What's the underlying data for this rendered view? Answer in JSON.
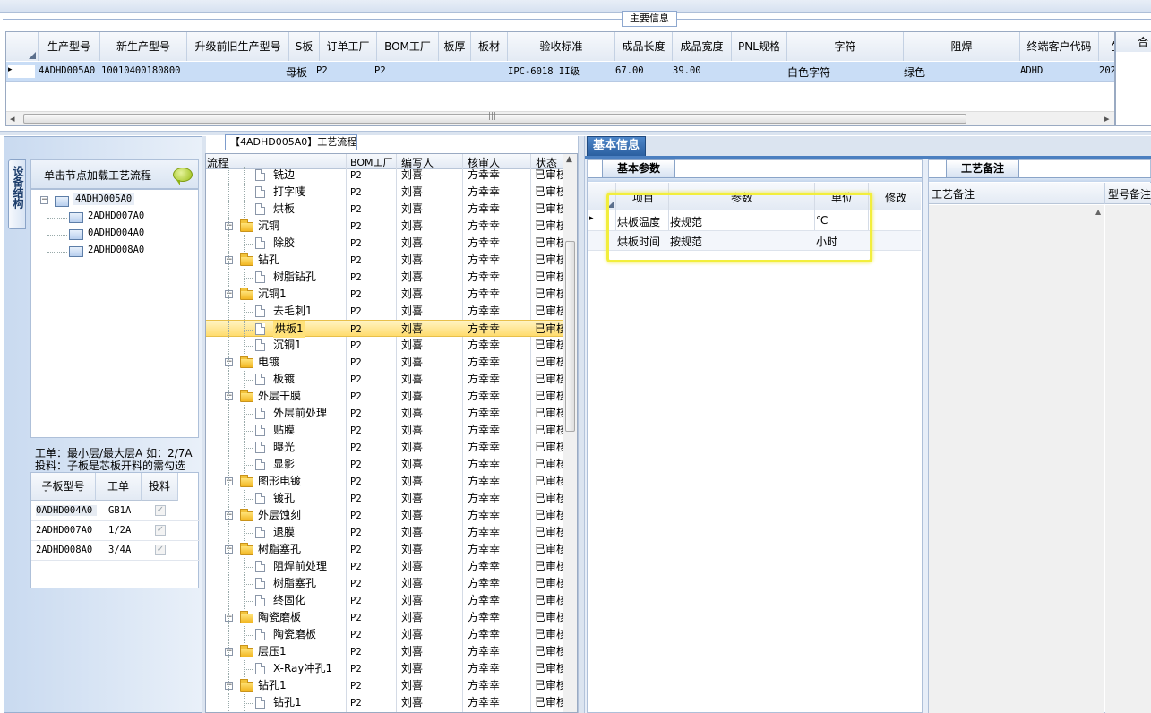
{
  "main_info": {
    "title": "主要信息",
    "columns": [
      "生产型号",
      "新生产型号",
      "升级前旧生产型号",
      "S板",
      "订单工厂",
      "BOM工厂",
      "板厚",
      "板材",
      "验收标准",
      "成品长度",
      "成品宽度",
      "PNL规格",
      "字符",
      "阻焊",
      "终端客户代码",
      "生"
    ],
    "row": [
      "4ADHD005A0",
      "10010400180800",
      "",
      "母板",
      "P2",
      "P2",
      "",
      "",
      "IPC-6018 II级",
      "67.00",
      "39.00",
      "",
      "白色字符",
      "绿色",
      "ADHD",
      "202"
    ],
    "right_header": "合",
    "row_indicator": "▸",
    "scroll_left": "◂",
    "scroll_right": "▸",
    "scroll_grip": "|||"
  },
  "left_panel": {
    "vertical_tab": "设备结构",
    "hint": "单击节点加载工艺流程",
    "tree_root": "4ADHD005A0",
    "tree_children": [
      "2ADHD007A0",
      "0ADHD004A0",
      "2ADHD008A0"
    ],
    "note_line1": "工单：最小层/最大层A 如：2/7A",
    "note_line2": "投料：子板是芯板开料的需勾选",
    "sub_columns": [
      "子板型号",
      "工单",
      "投料"
    ],
    "sub_rows": [
      {
        "model": "0ADHD004A0",
        "order": "GB1A",
        "feed": "✓"
      },
      {
        "model": "2ADHD007A0",
        "order": "1/2A",
        "feed": "✓"
      },
      {
        "model": "2ADHD008A0",
        "order": "3/4A",
        "feed": "✓"
      }
    ]
  },
  "flow_panel": {
    "title": "【4ADHD005A0】工艺流程",
    "columns": [
      "流程",
      "BOM工厂",
      "编写人",
      "核审人",
      "状态"
    ],
    "rows": [
      {
        "name": "铣边",
        "type": "leaf",
        "bom": "P2",
        "writer": "刘喜",
        "reviewer": "方幸幸",
        "status": "已审核"
      },
      {
        "name": "打字唛",
        "type": "leaf",
        "bom": "P2",
        "writer": "刘喜",
        "reviewer": "方幸幸",
        "status": "已审核"
      },
      {
        "name": "烘板",
        "type": "leaf",
        "bom": "P2",
        "writer": "刘喜",
        "reviewer": "方幸幸",
        "status": "已审核"
      },
      {
        "name": "沉铜",
        "type": "folder",
        "bom": "P2",
        "writer": "刘喜",
        "reviewer": "方幸幸",
        "status": "已审核"
      },
      {
        "name": "除胶",
        "type": "leaf",
        "bom": "P2",
        "writer": "刘喜",
        "reviewer": "方幸幸",
        "status": "已审核"
      },
      {
        "name": "钻孔",
        "type": "folder",
        "bom": "P2",
        "writer": "刘喜",
        "reviewer": "方幸幸",
        "status": "已审核"
      },
      {
        "name": "树脂钻孔",
        "type": "leaf",
        "bom": "P2",
        "writer": "刘喜",
        "reviewer": "方幸幸",
        "status": "已审核"
      },
      {
        "name": "沉铜1",
        "type": "folder",
        "bom": "P2",
        "writer": "刘喜",
        "reviewer": "方幸幸",
        "status": "已审核"
      },
      {
        "name": "去毛刺1",
        "type": "leaf",
        "bom": "P2",
        "writer": "刘喜",
        "reviewer": "方幸幸",
        "status": "已审核"
      },
      {
        "name": "烘板1",
        "type": "leaf",
        "bom": "P2",
        "writer": "刘喜",
        "reviewer": "方幸幸",
        "status": "已审核",
        "selected": true
      },
      {
        "name": "沉铜1",
        "type": "leaf",
        "bom": "P2",
        "writer": "刘喜",
        "reviewer": "方幸幸",
        "status": "已审核"
      },
      {
        "name": "电镀",
        "type": "folder",
        "bom": "P2",
        "writer": "刘喜",
        "reviewer": "方幸幸",
        "status": "已审核"
      },
      {
        "name": "板镀",
        "type": "leaf",
        "bom": "P2",
        "writer": "刘喜",
        "reviewer": "方幸幸",
        "status": "已审核"
      },
      {
        "name": "外层干膜",
        "type": "folder",
        "bom": "P2",
        "writer": "刘喜",
        "reviewer": "方幸幸",
        "status": "已审核"
      },
      {
        "name": "外层前处理",
        "type": "leaf",
        "bom": "P2",
        "writer": "刘喜",
        "reviewer": "方幸幸",
        "status": "已审核"
      },
      {
        "name": "贴膜",
        "type": "leaf",
        "bom": "P2",
        "writer": "刘喜",
        "reviewer": "方幸幸",
        "status": "已审核"
      },
      {
        "name": "曝光",
        "type": "leaf",
        "bom": "P2",
        "writer": "刘喜",
        "reviewer": "方幸幸",
        "status": "已审核"
      },
      {
        "name": "显影",
        "type": "leaf",
        "bom": "P2",
        "writer": "刘喜",
        "reviewer": "方幸幸",
        "status": "已审核"
      },
      {
        "name": "图形电镀",
        "type": "folder",
        "bom": "P2",
        "writer": "刘喜",
        "reviewer": "方幸幸",
        "status": "已审核"
      },
      {
        "name": "镀孔",
        "type": "leaf",
        "bom": "P2",
        "writer": "刘喜",
        "reviewer": "方幸幸",
        "status": "已审核"
      },
      {
        "name": "外层蚀刻",
        "type": "folder",
        "bom": "P2",
        "writer": "刘喜",
        "reviewer": "方幸幸",
        "status": "已审核"
      },
      {
        "name": "退膜",
        "type": "leaf",
        "bom": "P2",
        "writer": "刘喜",
        "reviewer": "方幸幸",
        "status": "已审核"
      },
      {
        "name": "树脂塞孔",
        "type": "folder",
        "bom": "P2",
        "writer": "刘喜",
        "reviewer": "方幸幸",
        "status": "已审核"
      },
      {
        "name": "阻焊前处理",
        "type": "leaf",
        "bom": "P2",
        "writer": "刘喜",
        "reviewer": "方幸幸",
        "status": "已审核"
      },
      {
        "name": "树脂塞孔",
        "type": "leaf",
        "bom": "P2",
        "writer": "刘喜",
        "reviewer": "方幸幸",
        "status": "已审核"
      },
      {
        "name": "终固化",
        "type": "leaf",
        "bom": "P2",
        "writer": "刘喜",
        "reviewer": "方幸幸",
        "status": "已审核"
      },
      {
        "name": "陶瓷磨板",
        "type": "folder",
        "bom": "P2",
        "writer": "刘喜",
        "reviewer": "方幸幸",
        "status": "已审核"
      },
      {
        "name": "陶瓷磨板",
        "type": "leaf",
        "bom": "P2",
        "writer": "刘喜",
        "reviewer": "方幸幸",
        "status": "已审核"
      },
      {
        "name": "层压1",
        "type": "folder",
        "bom": "P2",
        "writer": "刘喜",
        "reviewer": "方幸幸",
        "status": "已审核"
      },
      {
        "name": "X-Ray冲孔1",
        "type": "leaf",
        "bom": "P2",
        "writer": "刘喜",
        "reviewer": "方幸幸",
        "status": "已审核"
      },
      {
        "name": "钻孔1",
        "type": "folder",
        "bom": "P2",
        "writer": "刘喜",
        "reviewer": "方幸幸",
        "status": "已审核"
      },
      {
        "name": "钻孔1",
        "type": "leaf",
        "bom": "P2",
        "writer": "刘喜",
        "reviewer": "方幸幸",
        "status": "已审核"
      }
    ]
  },
  "basic_info": {
    "tab": "基本信息",
    "sub_tab": "基本参数",
    "columns": [
      "项目",
      "参数",
      "单位",
      "修改"
    ],
    "rows": [
      {
        "item": "烘板温度",
        "param": "按规范",
        "unit": "℃"
      },
      {
        "item": "烘板时间",
        "param": "按规范",
        "unit": "小时"
      }
    ]
  },
  "remarks": {
    "tab": "工艺备注",
    "col1": "工艺备注",
    "col2": "型号备注"
  }
}
